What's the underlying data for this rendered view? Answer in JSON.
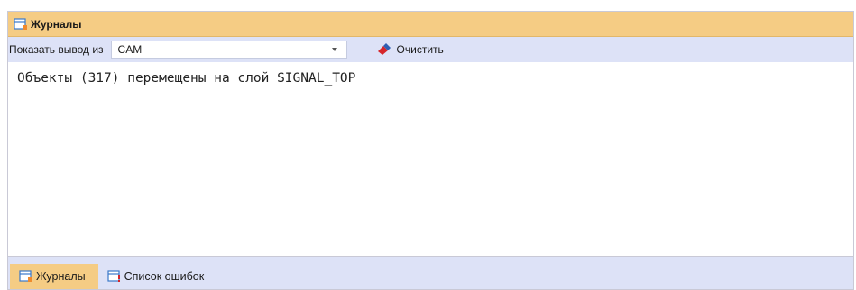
{
  "panel": {
    "title": "Журналы",
    "title_icon": "journal-icon",
    "header_color": "#f5cc84",
    "toolbar_color": "#dde2f7"
  },
  "toolbar": {
    "show_output_label": "Показать вывод из",
    "source_value": "CAM",
    "clear_label": "Очистить",
    "clear_icon": "eraser-icon"
  },
  "output": {
    "lines": [
      "Объекты (317) перемещены на слой SIGNAL_TOP"
    ]
  },
  "tabs": [
    {
      "label": "Журналы",
      "icon": "journal-icon",
      "active": true
    },
    {
      "label": "Список ошибок",
      "icon": "error-list-icon",
      "active": false
    }
  ]
}
